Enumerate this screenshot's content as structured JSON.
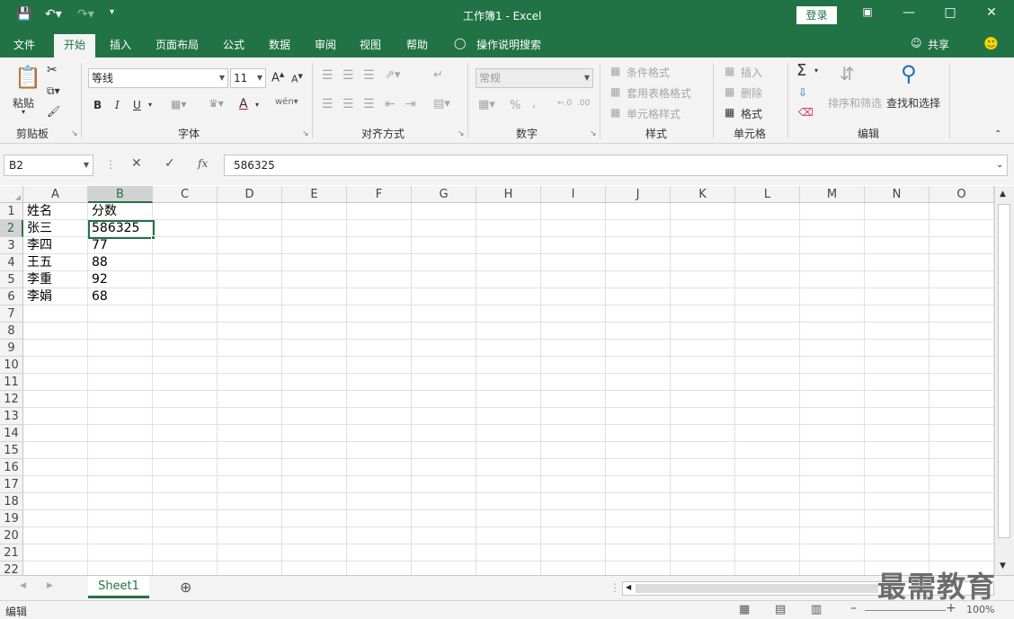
{
  "window": {
    "title": "工作簿1  -  Excel",
    "login": "登录"
  },
  "tabs": [
    "文件",
    "开始",
    "插入",
    "页面布局",
    "公式",
    "数据",
    "审阅",
    "视图",
    "帮助",
    "操作说明搜索",
    "共享"
  ],
  "ribbon": {
    "clipboard": {
      "paste": "粘贴",
      "label": "剪贴板"
    },
    "font": {
      "name": "等线",
      "size": "11",
      "bold": "B",
      "italic": "I",
      "underline": "U",
      "label": "字体"
    },
    "alignment": {
      "label": "对齐方式"
    },
    "number": {
      "format": "常规",
      "label": "数字"
    },
    "styles": {
      "cond": "条件格式",
      "table": "套用表格格式",
      "cell": "单元格样式",
      "label": "样式"
    },
    "cells": {
      "insert": "插入",
      "delete": "删除",
      "format": "格式",
      "label": "单元格"
    },
    "editing": {
      "sort": "排序和筛选",
      "find": "查找和选择",
      "label": "编辑"
    }
  },
  "formula_bar": {
    "namebox": "B2",
    "fx": "fx",
    "value": "586325"
  },
  "columns": [
    "A",
    "B",
    "C",
    "D",
    "E",
    "F",
    "G",
    "H",
    "I",
    "J",
    "K",
    "L",
    "M",
    "N",
    "O"
  ],
  "rows": [
    "1",
    "2",
    "3",
    "4",
    "5",
    "6",
    "7",
    "8",
    "9",
    "10",
    "11",
    "12",
    "13",
    "14",
    "15",
    "16",
    "17",
    "18",
    "19",
    "20",
    "21",
    "22"
  ],
  "cells": {
    "A1": "姓名",
    "B1": "分数",
    "A2": "张三",
    "B2": "586325",
    "A3": "李四",
    "B3": "77",
    "A4": "王五",
    "B4": "88",
    "A5": "李重",
    "B5": "92",
    "A6": "李娟",
    "B6": "68"
  },
  "sheet": {
    "name": "Sheet1"
  },
  "status": {
    "mode": "编辑",
    "zoom": "100%"
  },
  "watermark": "最需教育",
  "colors": {
    "accent": "#217346"
  }
}
